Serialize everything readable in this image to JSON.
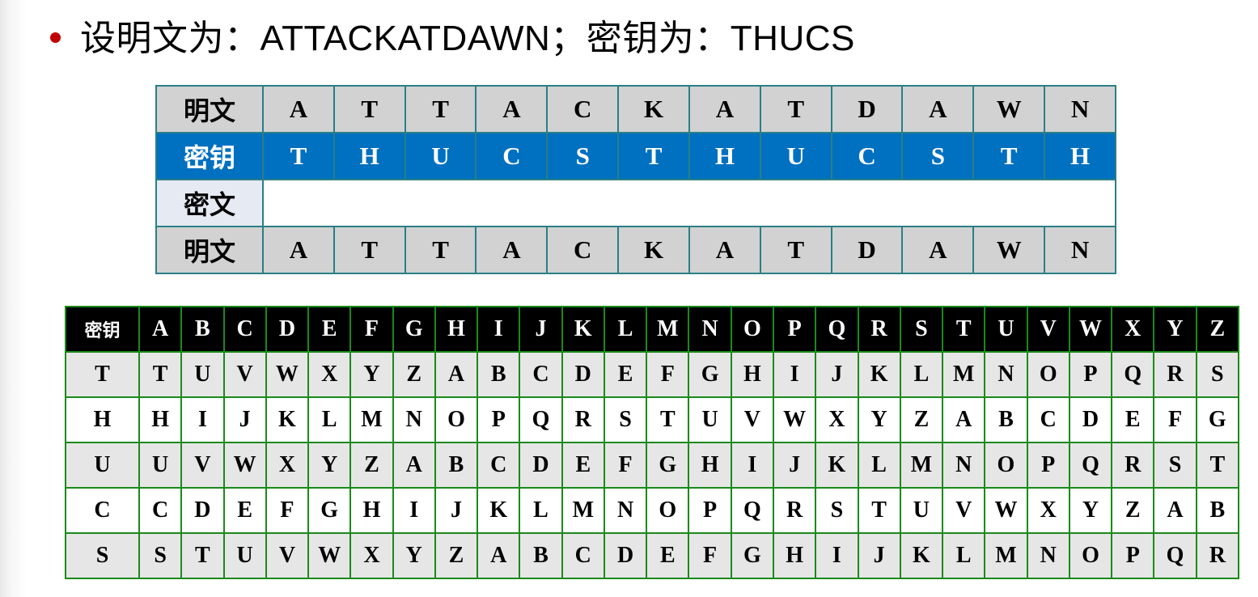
{
  "title": "设明文为：ATTACKATDAWN；密钥为：THUCS",
  "example_table": {
    "rows": [
      {
        "label": "明文",
        "cells": [
          "A",
          "T",
          "T",
          "A",
          "C",
          "K",
          "A",
          "T",
          "D",
          "A",
          "W",
          "N"
        ]
      },
      {
        "label": "密钥",
        "cells": [
          "T",
          "H",
          "U",
          "C",
          "S",
          "T",
          "H",
          "U",
          "C",
          "S",
          "T",
          "H"
        ]
      },
      {
        "label": "密文",
        "cells": []
      },
      {
        "label": "明文",
        "cells": [
          "A",
          "T",
          "T",
          "A",
          "C",
          "K",
          "A",
          "T",
          "D",
          "A",
          "W",
          "N"
        ]
      }
    ]
  },
  "vigenere_square": {
    "header_label": "密钥",
    "header": [
      "A",
      "B",
      "C",
      "D",
      "E",
      "F",
      "G",
      "H",
      "I",
      "J",
      "K",
      "L",
      "M",
      "N",
      "O",
      "P",
      "Q",
      "R",
      "S",
      "T",
      "U",
      "V",
      "W",
      "X",
      "Y",
      "Z"
    ],
    "rows": [
      {
        "key": "T",
        "cells": [
          "T",
          "U",
          "V",
          "W",
          "X",
          "Y",
          "Z",
          "A",
          "B",
          "C",
          "D",
          "E",
          "F",
          "G",
          "H",
          "I",
          "J",
          "K",
          "L",
          "M",
          "N",
          "O",
          "P",
          "Q",
          "R",
          "S"
        ]
      },
      {
        "key": "H",
        "cells": [
          "H",
          "I",
          "J",
          "K",
          "L",
          "M",
          "N",
          "O",
          "P",
          "Q",
          "R",
          "S",
          "T",
          "U",
          "V",
          "W",
          "X",
          "Y",
          "Z",
          "A",
          "B",
          "C",
          "D",
          "E",
          "F",
          "G"
        ]
      },
      {
        "key": "U",
        "cells": [
          "U",
          "V",
          "W",
          "X",
          "Y",
          "Z",
          "A",
          "B",
          "C",
          "D",
          "E",
          "F",
          "G",
          "H",
          "I",
          "J",
          "K",
          "L",
          "M",
          "N",
          "O",
          "P",
          "Q",
          "R",
          "S",
          "T"
        ]
      },
      {
        "key": "C",
        "cells": [
          "C",
          "D",
          "E",
          "F",
          "G",
          "H",
          "I",
          "J",
          "K",
          "L",
          "M",
          "N",
          "O",
          "P",
          "Q",
          "R",
          "S",
          "T",
          "U",
          "V",
          "W",
          "X",
          "Y",
          "Z",
          "A",
          "B"
        ]
      },
      {
        "key": "S",
        "cells": [
          "S",
          "T",
          "U",
          "V",
          "W",
          "X",
          "Y",
          "Z",
          "A",
          "B",
          "C",
          "D",
          "E",
          "F",
          "G",
          "H",
          "I",
          "J",
          "K",
          "L",
          "M",
          "N",
          "O",
          "P",
          "Q",
          "R"
        ]
      }
    ]
  },
  "colors": {
    "bullet": "#c00000",
    "key_row": "#0070c0",
    "plaintext_row": "#d2d2d2",
    "top_table_border": "#2a7f86",
    "square_border": "#1a8a1a",
    "square_header": "#000000"
  }
}
